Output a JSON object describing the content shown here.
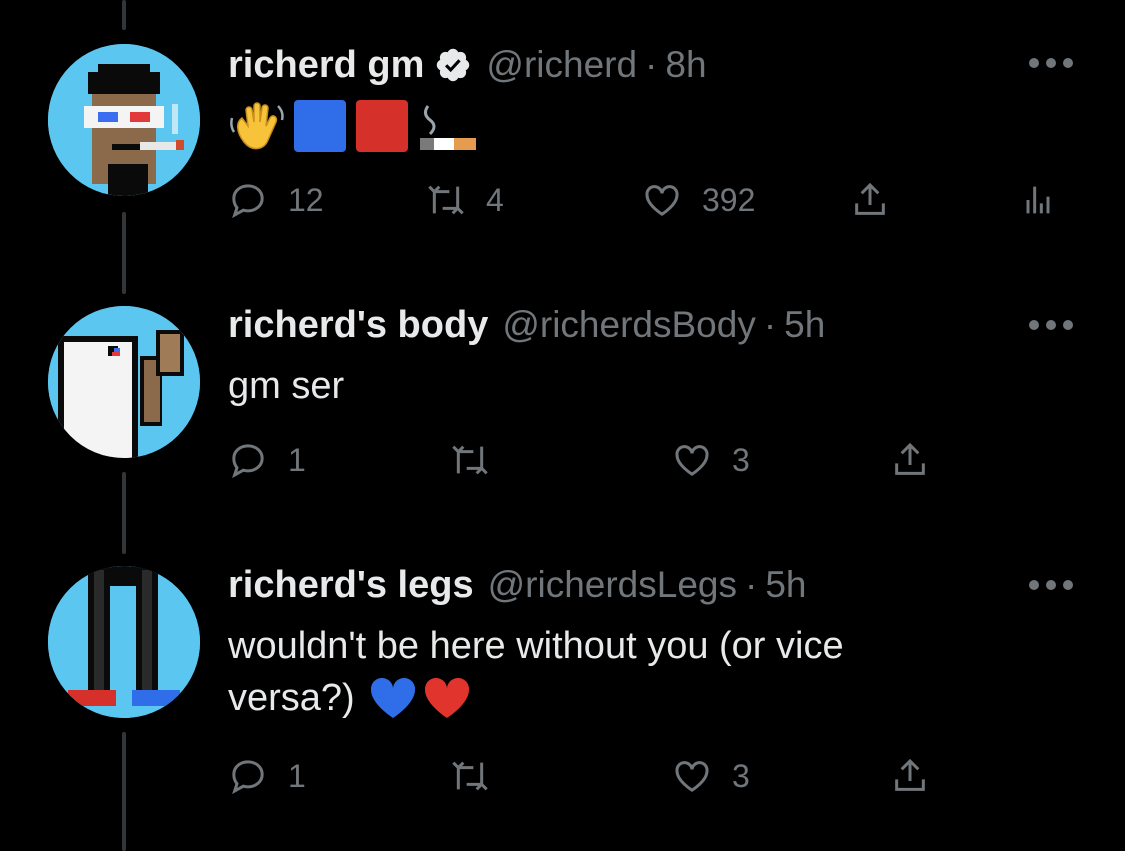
{
  "colors": {
    "background": "#000000",
    "text": "#e7e9ea",
    "muted": "#71767b",
    "thread_line": "#333639",
    "avatar_bg": "#5bc6ef"
  },
  "tweets": [
    {
      "name": "richerd gm",
      "verified": true,
      "handle": "@richerd",
      "dot": "·",
      "time": "8h",
      "text": "",
      "emojis": [
        "waving-hand",
        "blue-square",
        "red-square",
        "cigarette"
      ],
      "actions": {
        "reply": "12",
        "retweet": "4",
        "like": "392"
      },
      "has_analytics": true
    },
    {
      "name": "richerd's body",
      "verified": false,
      "handle": "@richerdsBody",
      "dot": "·",
      "time": "5h",
      "text": "gm ser",
      "actions": {
        "reply": "1",
        "retweet": "",
        "like": "3"
      }
    },
    {
      "name": "richerd's legs",
      "verified": false,
      "handle": "@richerdsLegs",
      "dot": "·",
      "time": "5h",
      "text_line1": "wouldn't be here without you (or vice",
      "text_line2": "versa?)",
      "text_emojis": [
        "blue-heart",
        "red-heart"
      ],
      "actions": {
        "reply": "1",
        "retweet": "",
        "like": "3"
      }
    }
  ]
}
